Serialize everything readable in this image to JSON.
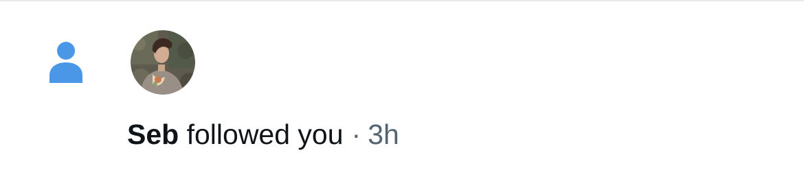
{
  "notification": {
    "type_icon": "person-icon",
    "actor_name": "Seb",
    "action": "followed you",
    "separator": "·",
    "timestamp": "3h"
  },
  "colors": {
    "icon_blue": "#4a97e8",
    "text_primary": "#0f1419",
    "text_secondary": "#536471",
    "divider": "#e7e9eb"
  }
}
